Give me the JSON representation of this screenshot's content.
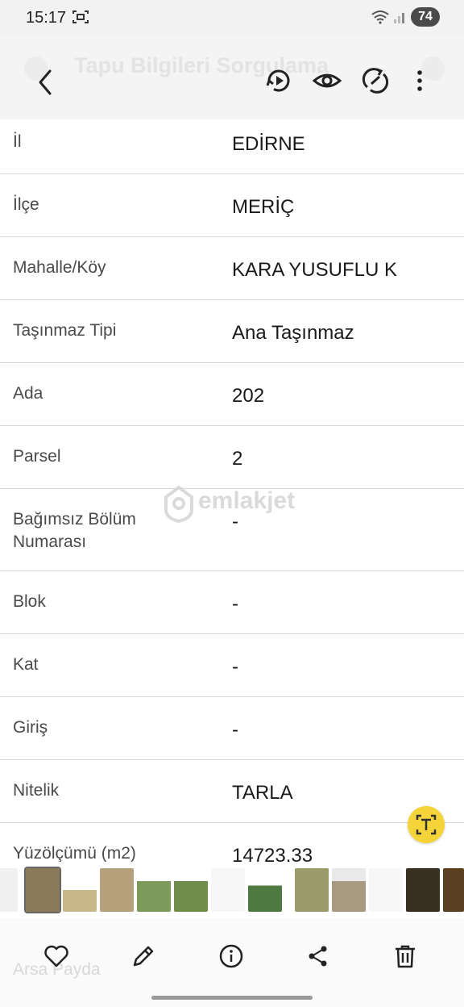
{
  "status_bar": {
    "time": "15:17",
    "battery": "74",
    "icons": [
      "screenshot-icon",
      "wifi-icon",
      "signal-icon"
    ]
  },
  "app_bar": {
    "title": "Tapu Bilgileri Sorgulama"
  },
  "toolbar": {
    "icons": [
      "back-arrow-icon",
      "play-rotate-icon",
      "eye-icon",
      "rotate-link-icon",
      "more-vertical-icon"
    ]
  },
  "rows": [
    {
      "label": "İl",
      "value": "EDİRNE"
    },
    {
      "label": "İlçe",
      "value": "MERİÇ"
    },
    {
      "label": "Mahalle/Köy",
      "value": "KARA YUSUFLU K"
    },
    {
      "label": "Taşınmaz Tipi",
      "value": "Ana Taşınmaz"
    },
    {
      "label": "Ada",
      "value": "202"
    },
    {
      "label": "Parsel",
      "value": "2"
    },
    {
      "label": "Bağımsız Bölüm Numarası",
      "value": "-"
    },
    {
      "label": "Blok",
      "value": "-"
    },
    {
      "label": "Kat",
      "value": "-"
    },
    {
      "label": "Giriş",
      "value": "-"
    },
    {
      "label": "Nitelik",
      "value": "TARLA"
    },
    {
      "label": "Yüzölçümü (m2)",
      "value": "14723.33"
    }
  ],
  "partial_row_label": "Arsa Payda",
  "watermark": "emlakjet",
  "bottom_actions": [
    "heart-icon",
    "pencil-icon",
    "info-icon",
    "share-icon",
    "trash-icon"
  ],
  "colors": {
    "fab": "#f5d43a",
    "divider": "#d9d9d9"
  }
}
